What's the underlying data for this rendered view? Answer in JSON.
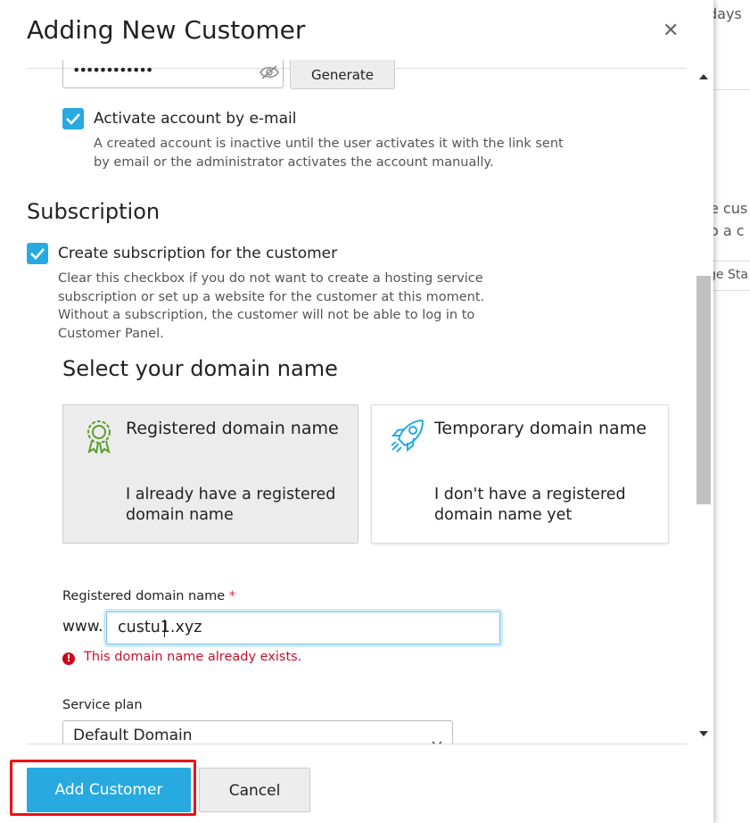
{
  "background": {
    "fragments": [
      "days",
      "e cus",
      "o a c",
      "ge Sta"
    ]
  },
  "dialog": {
    "title": "Adding New Customer",
    "close_icon": "close-icon"
  },
  "password": {
    "masked_value": "••••••••••••",
    "toggle_icon": "eye-slash-icon",
    "generate_label": "Generate"
  },
  "activate": {
    "checked": true,
    "label": "Activate account by e-mail",
    "hint_line1": "A created account is inactive until the user activates it with the link sent",
    "hint_line2": "by email or the administrator activates the account manually."
  },
  "subscription": {
    "heading": "Subscription",
    "checkbox_checked": true,
    "checkbox_label": "Create subscription for the customer",
    "hint_lines": [
      "Clear this checkbox if you do not want to create a hosting service",
      "subscription or set up a website for the customer at this moment.",
      "Without a subscription, the customer will not be able to log in to",
      "Customer Panel."
    ]
  },
  "domain_choice": {
    "heading": "Select your domain name",
    "cards": [
      {
        "title": "Registered domain name",
        "description": "I already have a registered domain name",
        "icon": "certificate-icon",
        "selected": true
      },
      {
        "title": "Temporary domain name",
        "description": "I don't have a registered domain name yet",
        "icon": "rocket-icon",
        "selected": false
      }
    ]
  },
  "domain_field": {
    "label": "Registered domain name",
    "required_mark": "*",
    "prefix": "www.",
    "value": "custu1.xyz",
    "error": "This domain name already exists."
  },
  "service_plan": {
    "label": "Service plan",
    "selected": "Default Domain"
  },
  "footer": {
    "add_label": "Add Customer",
    "cancel_label": "Cancel"
  },
  "colors": {
    "accent": "#28aae1",
    "error": "#c8102e",
    "highlight": "#ee1111"
  }
}
